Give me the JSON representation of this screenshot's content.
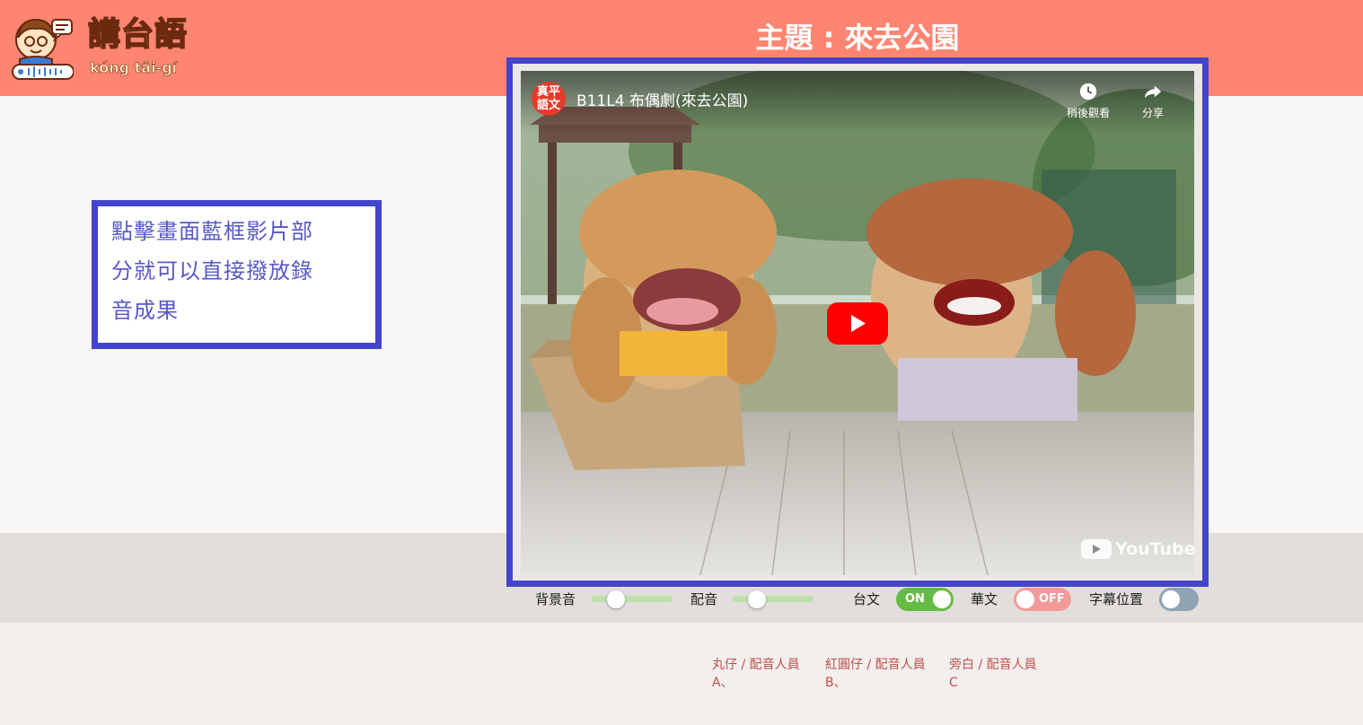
{
  "header": {
    "logo_title": "講台語",
    "logo_subtitle": "kóng tâi-gí",
    "topic": "主題 : 來去公園"
  },
  "hint": {
    "text_lines": [
      "點擊畫面藍框影片部",
      "分就可以直接撥放錄",
      "音成果"
    ]
  },
  "video": {
    "channel_badge": "真平\n語文",
    "title": "B11L4 布偶劇(來去公園)",
    "watch_later": "稍後觀看",
    "share": "分享",
    "brand": "YouTube"
  },
  "controls": {
    "bgm_label": "背景音",
    "bgm_level": 0.3,
    "dub_label": "配音",
    "dub_level": 0.3,
    "taiwanese_label": "台文",
    "taiwanese_state": "ON",
    "mandarin_label": "華文",
    "mandarin_state": "OFF",
    "subtitle_pos_label": "字幕位置"
  },
  "credits": [
    {
      "role": "丸仔 / 配音人員",
      "name": "A、"
    },
    {
      "role": "紅圓仔 / 配音人員",
      "name": "B、"
    },
    {
      "role": "旁白 / 配音人員",
      "name": "C"
    }
  ],
  "colors": {
    "header_bg": "#fe8571",
    "frame_blue": "#4444cc",
    "toggle_on": "#66bb44",
    "toggle_off": "#f29a9a",
    "toggle_neutral": "#8fa4b3"
  }
}
